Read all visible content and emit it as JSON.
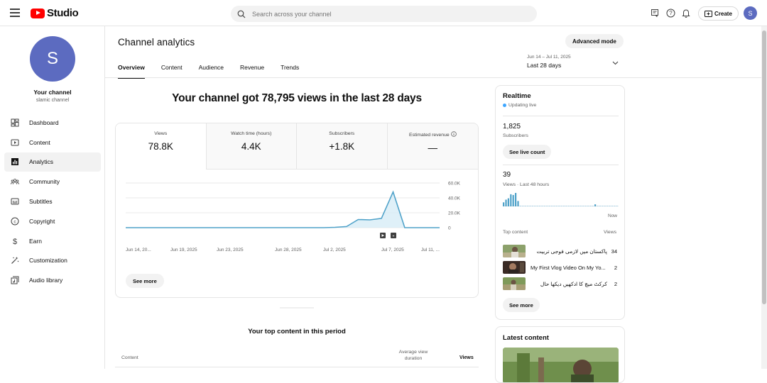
{
  "header": {
    "logo_text": "Studio",
    "search_placeholder": "Search across your channel",
    "create_label": "Create",
    "avatar_letter": "S"
  },
  "sidebar": {
    "avatar_letter": "S",
    "channel_title": "Your channel",
    "channel_handle": "slamic channel",
    "items": [
      {
        "label": "Dashboard",
        "icon": "dashboard-icon"
      },
      {
        "label": "Content",
        "icon": "content-icon"
      },
      {
        "label": "Analytics",
        "icon": "analytics-icon",
        "active": true
      },
      {
        "label": "Community",
        "icon": "community-icon"
      },
      {
        "label": "Subtitles",
        "icon": "subtitles-icon"
      },
      {
        "label": "Copyright",
        "icon": "copyright-icon"
      },
      {
        "label": "Earn",
        "icon": "earn-icon"
      },
      {
        "label": "Customization",
        "icon": "customization-icon"
      },
      {
        "label": "Audio library",
        "icon": "audio-library-icon"
      }
    ]
  },
  "main": {
    "title": "Channel analytics",
    "advanced_mode_label": "Advanced mode",
    "tabs": [
      "Overview",
      "Content",
      "Audience",
      "Revenue",
      "Trends"
    ],
    "active_tab": "Overview",
    "date_range": {
      "range": "Jun 14 – Jul 11, 2025",
      "label": "Last 28 days"
    },
    "headline": "Your channel got 78,795 views in the last 28 days",
    "metrics": [
      {
        "label": "Views",
        "value": "78.8K"
      },
      {
        "label": "Watch time (hours)",
        "value": "4.4K"
      },
      {
        "label": "Subscribers",
        "value": "+1.8K"
      },
      {
        "label": "Estimated revenue",
        "value": "—"
      }
    ],
    "see_more_label": "See more",
    "top_content": {
      "title": "Your top content in this period",
      "col_content": "Content",
      "col_avg_duration_line1": "Average view",
      "col_avg_duration_line2": "duration",
      "col_views": "Views"
    }
  },
  "chart_data": {
    "type": "line",
    "x": [
      "Jun 14",
      "Jun 15",
      "Jun 16",
      "Jun 17",
      "Jun 18",
      "Jun 19",
      "Jun 20",
      "Jun 21",
      "Jun 22",
      "Jun 23",
      "Jun 24",
      "Jun 25",
      "Jun 26",
      "Jun 27",
      "Jun 28",
      "Jun 29",
      "Jun 30",
      "Jul 1",
      "Jul 2",
      "Jul 3",
      "Jul 4",
      "Jul 5",
      "Jul 6",
      "Jul 7",
      "Jul 8",
      "Jul 9",
      "Jul 10",
      "Jul 11"
    ],
    "series": [
      {
        "values": [
          0,
          0,
          0,
          0,
          0,
          0,
          0,
          0,
          0,
          0,
          0,
          0,
          0,
          0,
          0,
          0,
          0,
          0,
          500,
          1500,
          11000,
          10500,
          12500,
          48000,
          0,
          0,
          0,
          0
        ]
      }
    ],
    "x_tick_labels": [
      "Jun 14, 20...",
      "Jun 19, 2025",
      "Jun 23, 2025",
      "Jun 28, 2025",
      "Jul 2, 2025",
      "Jul 7, 2025",
      "Jul 11, ..."
    ],
    "y_tick_labels": [
      "60.0K",
      "40.0K",
      "20.0K",
      "0"
    ],
    "ylim": [
      0,
      60000
    ],
    "grid": true,
    "line_color": "#4fa2c9"
  },
  "realtime": {
    "title": "Realtime",
    "status": "Updating live",
    "subscribers_value": "1,825",
    "subscribers_label": "Subscribers",
    "see_live_count_label": "See live count",
    "views_value": "39",
    "views_label": "Views · Last 48 hours",
    "now_label": "Now",
    "top_content_label": "Top content",
    "views_col_label": "Views",
    "items": [
      {
        "title": "پاکستان میں لازمی فوجی تربیت",
        "views": "34"
      },
      {
        "title": "My First Vlog Video On My Yo...",
        "views": "2"
      },
      {
        "title": "کرکٹ میچ کا ادکھیں دیکھا حال",
        "views": "2"
      }
    ],
    "see_more_label": "See more",
    "bars_48h": [
      0.3,
      0.5,
      0.6,
      0.9,
      0.85,
      1.0,
      0.4,
      0,
      0,
      0,
      0,
      0,
      0,
      0,
      0,
      0,
      0,
      0,
      0,
      0,
      0,
      0,
      0,
      0,
      0,
      0,
      0,
      0,
      0,
      0,
      0,
      0,
      0,
      0,
      0,
      0,
      0,
      0,
      0.15,
      0,
      0,
      0,
      0,
      0,
      0,
      0,
      0,
      0
    ],
    "latest_content_title": "Latest content"
  },
  "colors": {
    "brand_red": "#ff0000",
    "avatar": "#5c6bc0",
    "chart_line": "#4fa2c9",
    "live_dot": "#3ea6ff"
  }
}
